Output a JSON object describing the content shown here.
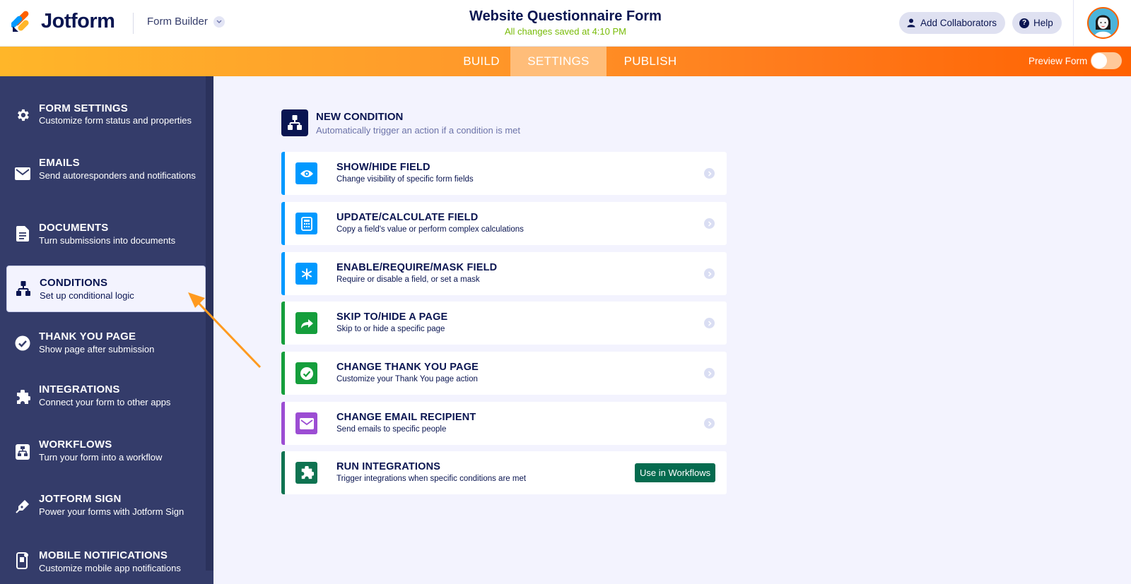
{
  "header": {
    "logo_text": "Jotform",
    "builder_label": "Form Builder",
    "form_title": "Website Questionnaire Form",
    "save_status": "All changes saved at 4:10 PM",
    "add_collaborators": "Add Collaborators",
    "help": "Help"
  },
  "tabs": {
    "build": "BUILD",
    "settings": "SETTINGS",
    "publish": "PUBLISH",
    "preview_label": "Preview Form"
  },
  "sidebar": {
    "items": [
      {
        "title": "FORM SETTINGS",
        "sub": "Customize form status and properties",
        "icon": "gear-icon"
      },
      {
        "title": "EMAILS",
        "sub": "Send autoresponders and notifications",
        "icon": "envelope-icon"
      },
      {
        "title": "DOCUMENTS",
        "sub": "Turn submissions into documents",
        "icon": "document-icon"
      },
      {
        "title": "CONDITIONS",
        "sub": "Set up conditional logic",
        "icon": "hierarchy-icon",
        "active": true
      },
      {
        "title": "THANK YOU PAGE",
        "sub": "Show page after submission",
        "icon": "check-circle-icon"
      },
      {
        "title": "INTEGRATIONS",
        "sub": "Connect your form to other apps",
        "icon": "puzzle-icon"
      },
      {
        "title": "WORKFLOWS",
        "sub": "Turn your form into a workflow",
        "icon": "workflow-icon"
      },
      {
        "title": "JOTFORM SIGN",
        "sub": "Power your forms with Jotform Sign",
        "icon": "pen-icon"
      },
      {
        "title": "MOBILE NOTIFICATIONS",
        "sub": "Customize mobile app notifications",
        "icon": "mobile-icon"
      }
    ]
  },
  "condition": {
    "title": "NEW CONDITION",
    "subtitle": "Automatically trigger an action if a condition is met",
    "options": [
      {
        "title": "SHOW/HIDE FIELD",
        "sub": "Change visibility of specific form fields",
        "icon": "eye-icon",
        "color": "#0099ff"
      },
      {
        "title": "UPDATE/CALCULATE FIELD",
        "sub": "Copy a field's value or perform complex calculations",
        "icon": "calculator-icon",
        "color": "#0099ff"
      },
      {
        "title": "ENABLE/REQUIRE/MASK FIELD",
        "sub": "Require or disable a field, or set a mask",
        "icon": "asterisk-icon",
        "color": "#0099ff"
      },
      {
        "title": "SKIP TO/HIDE A PAGE",
        "sub": "Skip to or hide a specific page",
        "icon": "share-arrow-icon",
        "color": "#18bd5b"
      },
      {
        "title": "CHANGE THANK YOU PAGE",
        "sub": "Customize your Thank You page action",
        "icon": "check-icon",
        "color": "#18bd5b"
      },
      {
        "title": "CHANGE EMAIL RECIPIENT",
        "sub": "Send emails to specific people",
        "icon": "envelope-icon",
        "color": "#9c4dd3"
      },
      {
        "title": "RUN INTEGRATIONS",
        "sub": "Trigger integrations when specific conditions are met",
        "icon": "puzzle-icon",
        "color": "#0f7351",
        "button": "Use in Workflows"
      }
    ]
  }
}
